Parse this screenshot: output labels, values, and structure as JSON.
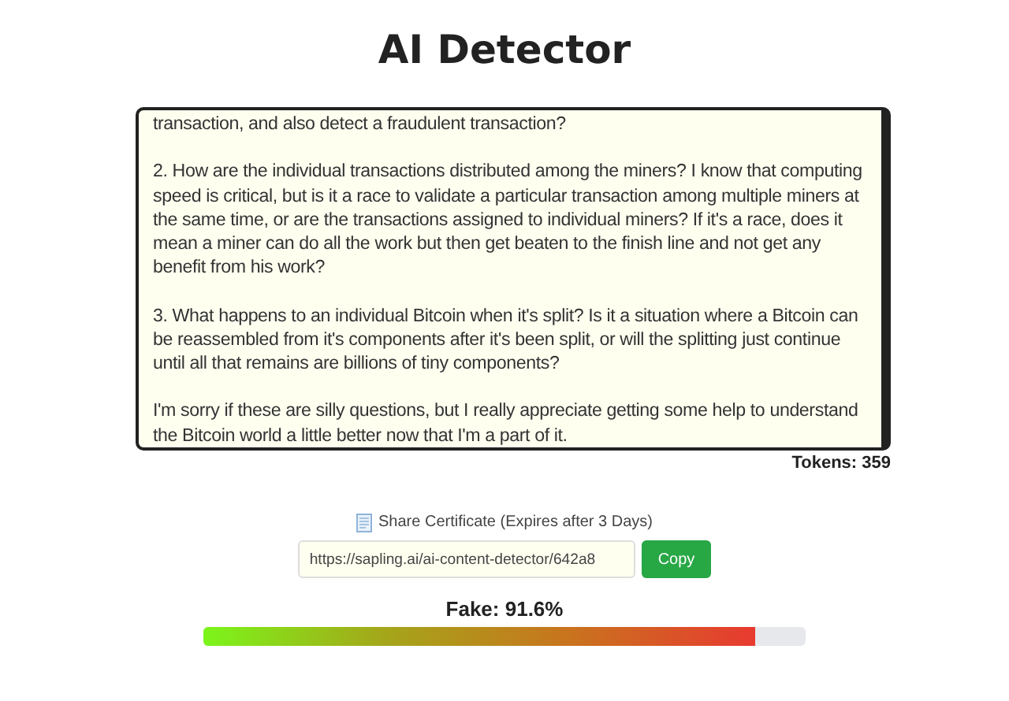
{
  "title": "AI Detector",
  "input": {
    "paragraphs": [
      "transaction, and also detect a fraudulent transaction?",
      "2. How are the individual transactions distributed among the miners?  I know that computing speed is critical, but is it a race to validate a particular transaction among multiple miners at the same time, or are the transactions assigned to individual miners? If it's a race, does it mean a miner can do all the work but then get beaten to the finish line and not get any benefit from his work?",
      "3. What happens to an individual Bitcoin when it's split? Is it a situation where a Bitcoin can be reassembled from it's components after it's been split, or will the splitting just continue until all that remains are billions of tiny components?",
      "I'm sorry if these are silly questions, but I really appreciate getting some help to understand the Bitcoin world a little better now that I'm a part of it."
    ]
  },
  "tokens": "Tokens: 359",
  "share": {
    "label": "Share Certificate (Expires after 3 Days)",
    "url": "https://sapling.ai/ai-content-detector/642a8",
    "button": "Copy"
  },
  "result": {
    "label": "Fake: 91.6%",
    "level": 0.916
  }
}
